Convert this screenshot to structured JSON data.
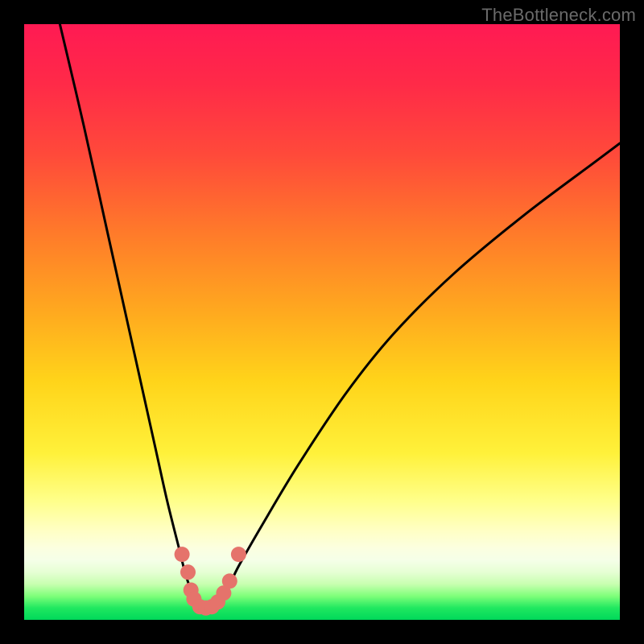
{
  "watermark": "TheBottleneck.com",
  "chart_data": {
    "type": "line",
    "title": "",
    "xlabel": "",
    "ylabel": "",
    "xlim": [
      0,
      100
    ],
    "ylim": [
      0,
      100
    ],
    "grid": false,
    "legend": false,
    "series": [
      {
        "name": "bottleneck-curve",
        "x": [
          6,
          10,
          14,
          18,
          22,
          24,
          26,
          27,
          28,
          29,
          30,
          31,
          32,
          34,
          36,
          40,
          46,
          54,
          62,
          72,
          84,
          96,
          100
        ],
        "y": [
          100,
          83,
          65,
          47,
          29,
          20,
          12,
          8,
          5,
          3,
          2,
          2,
          3,
          5,
          9,
          16,
          26,
          38,
          48,
          58,
          68,
          77,
          80
        ]
      }
    ],
    "markers": {
      "name": "highlight-dots",
      "color": "#e5736b",
      "points": [
        {
          "x": 26.5,
          "y": 11
        },
        {
          "x": 27.5,
          "y": 8
        },
        {
          "x": 28.0,
          "y": 5
        },
        {
          "x": 28.5,
          "y": 3.5
        },
        {
          "x": 29.5,
          "y": 2.2
        },
        {
          "x": 30.5,
          "y": 2.0
        },
        {
          "x": 31.5,
          "y": 2.2
        },
        {
          "x": 32.5,
          "y": 3.0
        },
        {
          "x": 33.5,
          "y": 4.5
        },
        {
          "x": 34.5,
          "y": 6.5
        },
        {
          "x": 36.0,
          "y": 11
        }
      ]
    },
    "gradient_stops": [
      {
        "pos": 0.0,
        "color": "#ff1a53"
      },
      {
        "pos": 0.35,
        "color": "#ff7a2a"
      },
      {
        "pos": 0.6,
        "color": "#ffd41a"
      },
      {
        "pos": 0.85,
        "color": "#ffffc4"
      },
      {
        "pos": 1.0,
        "color": "#00d85a"
      }
    ]
  }
}
